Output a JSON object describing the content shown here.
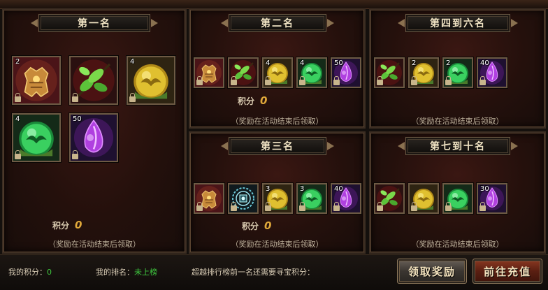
{
  "panels": {
    "first": {
      "title": "第一名",
      "score_label": "积分",
      "score": "0",
      "note": "（奖励在活动结束后领取）"
    },
    "second": {
      "title": "第二名",
      "score_label": "积分",
      "score": "0",
      "note": "（奖励在活动结束后领取）"
    },
    "third": {
      "title": "第三名",
      "score_label": "积分",
      "score": "0",
      "note": "（奖励在活动结束后领取）"
    },
    "four_to_six": {
      "title": "第四到六名",
      "note": "（奖励在活动结束后领取）"
    },
    "seven_to_ten": {
      "title": "第七到十名",
      "note": "（奖励在活动结束后领取）"
    }
  },
  "items": {
    "first": [
      {
        "icon": "golden-armor-icon",
        "count": "2"
      },
      {
        "icon": "green-leaf-icon",
        "count": ""
      },
      {
        "icon": "gold-wing-orb-icon",
        "count": "4"
      },
      {
        "icon": "green-wing-orb-icon",
        "count": "4"
      },
      {
        "icon": "purple-crystal-icon",
        "count": "50"
      }
    ],
    "second": [
      {
        "icon": "golden-armor-icon",
        "count": ""
      },
      {
        "icon": "green-leaf-icon",
        "count": ""
      },
      {
        "icon": "gold-wing-orb-icon",
        "count": "4"
      },
      {
        "icon": "green-wing-orb-icon",
        "count": "4"
      },
      {
        "icon": "purple-crystal-icon",
        "count": "50"
      }
    ],
    "third": [
      {
        "icon": "golden-armor-icon",
        "count": ""
      },
      {
        "icon": "teal-rune-icon",
        "count": ""
      },
      {
        "icon": "gold-wing-orb-icon",
        "count": "3"
      },
      {
        "icon": "green-wing-orb-icon",
        "count": "3"
      },
      {
        "icon": "purple-crystal-icon",
        "count": "40"
      }
    ],
    "four_to_six": [
      {
        "icon": "green-leaf-icon",
        "count": ""
      },
      {
        "icon": "gold-wing-orb-icon",
        "count": "2"
      },
      {
        "icon": "green-wing-orb-icon",
        "count": "2"
      },
      {
        "icon": "purple-crystal-icon",
        "count": "40"
      }
    ],
    "seven_to_ten": [
      {
        "icon": "green-leaf-icon",
        "count": ""
      },
      {
        "icon": "gold-wing-orb-icon",
        "count": ""
      },
      {
        "icon": "green-wing-orb-icon",
        "count": ""
      },
      {
        "icon": "purple-crystal-icon",
        "count": "30"
      }
    ]
  },
  "footer": {
    "my_score_label": "我的积分：",
    "my_score": "0",
    "my_rank_label": "我的排名：",
    "my_rank": "未上榜",
    "surpass_label": "超越排行榜前一名还需要寻宝积分："
  },
  "buttons": {
    "claim": "领取奖励",
    "recharge": "前往充值"
  },
  "colors": {
    "accent_gold": "#e0a83a",
    "status_green": "#3fc93f",
    "title_text": "#f1e4c4"
  }
}
